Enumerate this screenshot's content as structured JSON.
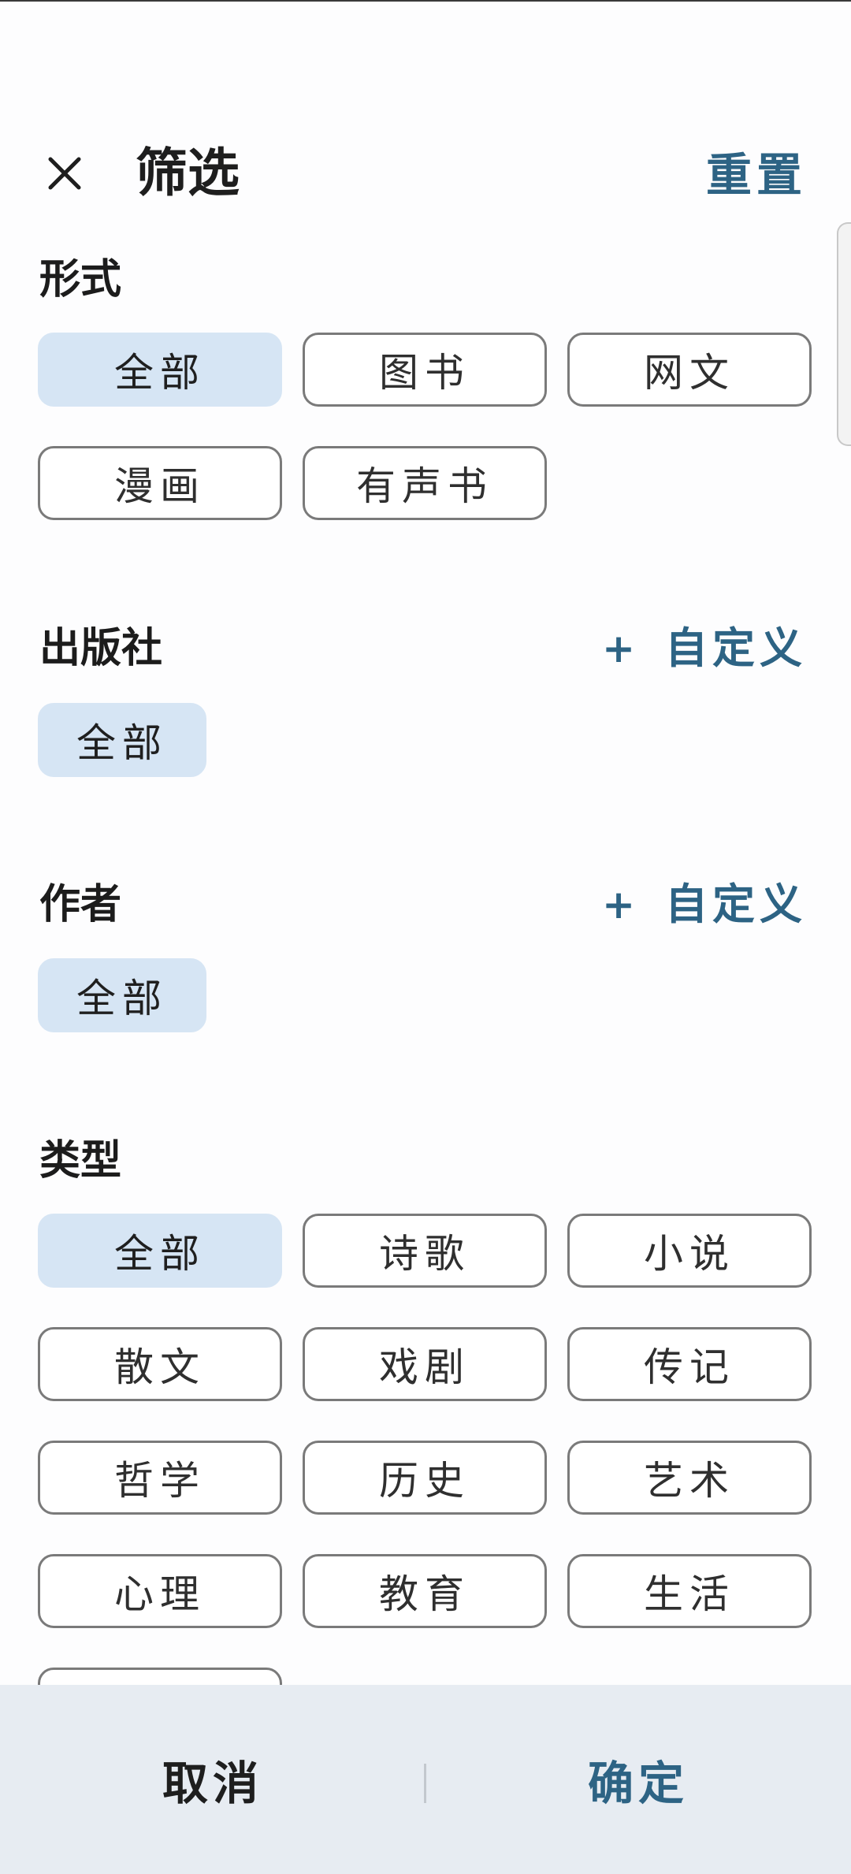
{
  "header": {
    "title": "筛选",
    "reset_label": "重置"
  },
  "sections": {
    "format": {
      "title": "形式",
      "chips": [
        "全部",
        "图书",
        "网文",
        "漫画",
        "有声书"
      ],
      "selected": "全部"
    },
    "publisher": {
      "title": "出版社",
      "custom_label": "自定义",
      "chips": [
        "全部"
      ],
      "selected": "全部"
    },
    "author": {
      "title": "作者",
      "custom_label": "自定义",
      "chips": [
        "全部"
      ],
      "selected": "全部"
    },
    "genre": {
      "title": "类型",
      "chips": [
        "全部",
        "诗歌",
        "小说",
        "散文",
        "戏剧",
        "传记",
        "哲学",
        "历史",
        "艺术",
        "心理",
        "教育",
        "生活"
      ],
      "selected": "全部"
    }
  },
  "footer": {
    "cancel_label": "取消",
    "confirm_label": "确定"
  },
  "icons": {
    "close": "close-icon",
    "plus": "plus-icon"
  },
  "colors": {
    "accent": "#2d6384",
    "selected_chip": "#d6e5f4",
    "footer_bg": "#e7ecf2"
  }
}
